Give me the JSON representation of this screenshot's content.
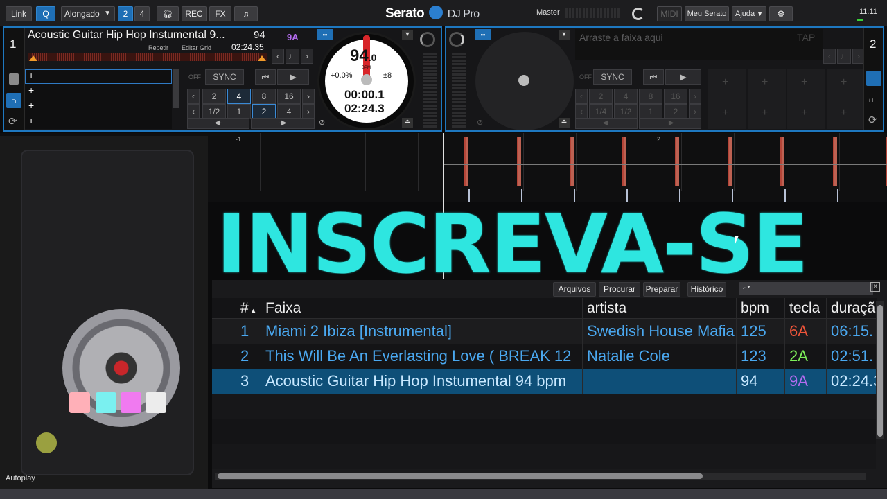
{
  "topbar": {
    "link": "Link",
    "mode": "Alongado",
    "deck2": "2",
    "deck4": "4",
    "rec": "REC",
    "fx": "FX",
    "brand_main": "Serato",
    "brand_sub": "DJ Pro",
    "master": "Master",
    "midi": "MIDI",
    "my_serato": "Meu Serato",
    "help": "Ajuda",
    "clock": "11:11"
  },
  "deck1": {
    "number": "1",
    "title": "Acoustic Guitar Hip Hop Instumental 9...",
    "bpm_small": "94",
    "key": "9A",
    "repeat": "Repetir",
    "edit_grid": "Editar Grid",
    "remaining": "02:24.35",
    "off": "OFF",
    "sync": "SYNC",
    "loop_row1": [
      "2",
      "4",
      "8",
      "16"
    ],
    "loop_row2": [
      "1/2",
      "1",
      "2",
      "4"
    ],
    "platter_bpm": "94",
    "platter_bpm_dec": ".0",
    "platter_bpm_label": "BPM",
    "pitch": "+0.0%",
    "range": "±8",
    "elapsed": "00:00.1",
    "total": "02:24.3"
  },
  "deck2": {
    "number": "2",
    "drop_hint": "Arraste a faixa aqui",
    "tap": "TAP",
    "off": "OFF",
    "sync": "SYNC",
    "loop_row1": [
      "2",
      "4",
      "8",
      "16"
    ],
    "loop_row2": [
      "1/4",
      "1/2",
      "1",
      "2"
    ]
  },
  "overview": {
    "marker_left": "-1",
    "marker_right": "2"
  },
  "overlay_text": "INSCREVA-SE",
  "library": {
    "tabs": [
      "Arquivos",
      "Procurar",
      "Preparar",
      "Histórico"
    ],
    "columns": [
      "#",
      "Faixa",
      "artista",
      "bpm",
      "tecla",
      "duraçã"
    ],
    "rows": [
      {
        "num": "1",
        "track": "Miami 2 Ibiza [Instrumental]",
        "artist": "Swedish House Mafia",
        "bpm": "125",
        "key": "6A",
        "duration": "06:15.",
        "key_color": "#f0553a"
      },
      {
        "num": "2",
        "track": "This Will Be An Everlasting Love ( BREAK 12",
        "artist": "Natalie Cole",
        "bpm": "123",
        "key": "2A",
        "duration": "02:51.",
        "key_color": "#7df05a"
      },
      {
        "num": "3",
        "track": "Acoustic Guitar Hip Hop Instumental 94 bpm",
        "artist": "",
        "bpm": "94",
        "key": "9A",
        "duration": "02:24.3",
        "key_color": "#b46cf0"
      }
    ]
  },
  "autoplay": "Autoplay",
  "colors": {
    "accent": "#1e78c0",
    "track_text": "#4aa8f0",
    "overlay": "#2ee6e0"
  }
}
